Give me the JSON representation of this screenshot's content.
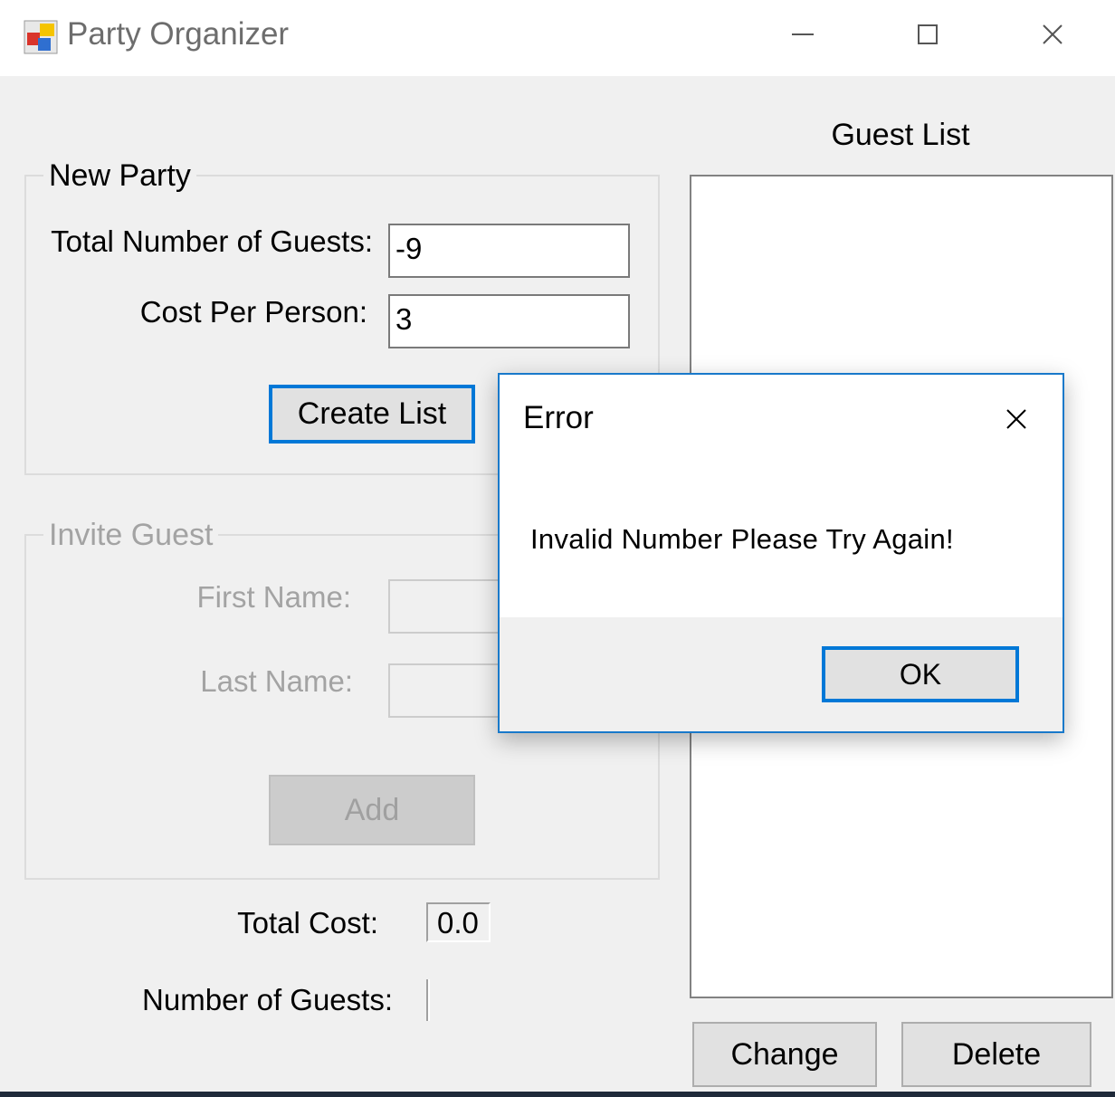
{
  "window": {
    "title": "Party Organizer",
    "icon": "app-icon",
    "controls": [
      "minimize-icon",
      "maximize-icon",
      "close-icon"
    ]
  },
  "new_party": {
    "legend": "New Party",
    "total_guests_label": "Total Number of Guests:",
    "total_guests_value": "-9",
    "cost_per_person_label": "Cost Per Person:",
    "cost_per_person_value": "3",
    "create_button": "Create List"
  },
  "invite_guest": {
    "legend": "Invite Guest",
    "first_name_label": "First Name:",
    "first_name_value": "",
    "last_name_label": "Last Name:",
    "last_name_value": "",
    "add_button": "Add"
  },
  "summary": {
    "total_cost_label": "Total Cost:",
    "total_cost_value": "0.0",
    "number_of_guests_label": "Number of Guests:",
    "number_of_guests_value": ""
  },
  "guest_list": {
    "title": "Guest List",
    "items": [],
    "change_button": "Change",
    "delete_button": "Delete"
  },
  "dialog": {
    "title": "Error",
    "message": "Invalid Number Please Try Again!",
    "ok_button": "OK"
  },
  "colors": {
    "accent": "#0078d7",
    "dialog_border": "#1979ca",
    "window_bg": "#f0f0f0"
  }
}
